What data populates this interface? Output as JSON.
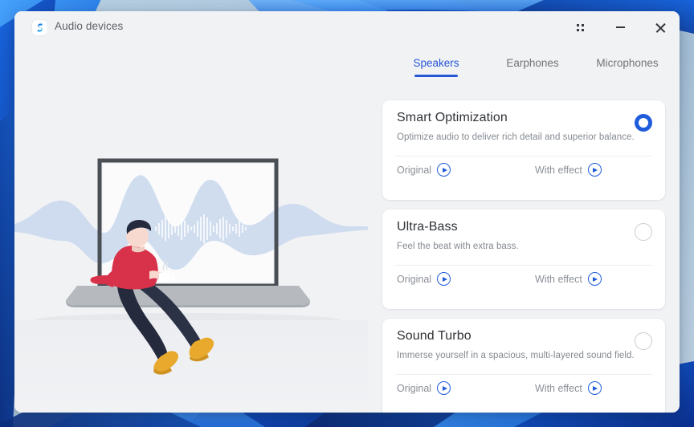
{
  "window": {
    "title": "Audio devices",
    "app_icon": "audio-swoosh-icon",
    "controls": {
      "snap": "snap-layouts",
      "minimize": "–",
      "close": "✕"
    }
  },
  "accent_colors": {
    "tab_active": "#2756d6",
    "radio_selected": "#1f5cdb",
    "play_button": "#1f5cdb",
    "card_background": "#ffffff",
    "window_background": "#f1f2f4"
  },
  "tabs": [
    {
      "label": "Speakers",
      "active": true
    },
    {
      "label": "Earphones",
      "active": false
    },
    {
      "label": "Microphones",
      "active": false
    }
  ],
  "illustration": {
    "name": "person-sitting-on-laptop-with-soundwave",
    "colors": {
      "sweater": "#d8324a",
      "pants": "#252a3d",
      "shoes": "#e8a92c",
      "hair": "#252a3d",
      "skin": "#f7d9cf",
      "wave": "#c9d8ee",
      "laptop_frame": "#4a4f55",
      "laptop_base": "#b6babf"
    }
  },
  "presets": [
    {
      "title": "Smart Optimization",
      "description": "Optimize audio to deliver rich detail and superior balance.",
      "selected": true,
      "original_label": "Original",
      "effect_label": "With effect"
    },
    {
      "title": "Ultra-Bass",
      "description": "Feel the beat with extra bass.",
      "selected": false,
      "original_label": "Original",
      "effect_label": "With effect"
    },
    {
      "title": "Sound Turbo",
      "description": "Immerse yourself in a spacious, multi-layered sound field.",
      "selected": false,
      "original_label": "Original",
      "effect_label": "With effect"
    }
  ]
}
